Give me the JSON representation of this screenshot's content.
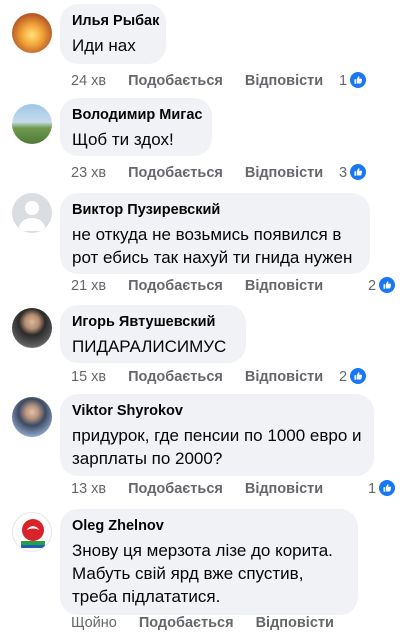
{
  "comments": [
    {
      "author": "Илья Рыбак",
      "text": "Иди нах",
      "time": "24 хв",
      "like": "Подобається",
      "reply": "Відповісти",
      "reactions": "1"
    },
    {
      "author": "Володимир Мигас",
      "text": "Щоб ти здох!",
      "time": "23 хв",
      "like": "Подобається",
      "reply": "Відповісти",
      "reactions": "3"
    },
    {
      "author": "Виктор Пузиревский",
      "text": "не откуда не возьмись появился в рот ебись так нахуй ти гнида нужен",
      "time": "21 хв",
      "like": "Подобається",
      "reply": "Відповісти",
      "reactions": "2"
    },
    {
      "author": "Игорь Явтушевский",
      "text": "ПИДАРАЛИСИМУС",
      "time": "15 хв",
      "like": "Подобається",
      "reply": "Відповісти",
      "reactions": "2"
    },
    {
      "author": "Viktor Shyrokov",
      "text": "придурок, где пенсии по 1000 евро и зарплаты по 2000?",
      "time": "13 хв",
      "like": "Подобається",
      "reply": "Відповісти",
      "reactions": "1"
    },
    {
      "author": "Oleg Zhelnov",
      "text": "Знову ця мерзота лізе до корита. Мабуть свій ярд вже спустив, треба підлататися.",
      "time": "Щойно",
      "like": "Подобається",
      "reply": "Відповісти"
    }
  ],
  "colors": {
    "bubble": "#f0f2f5",
    "meta": "#65676b",
    "like": "#1877f2"
  }
}
